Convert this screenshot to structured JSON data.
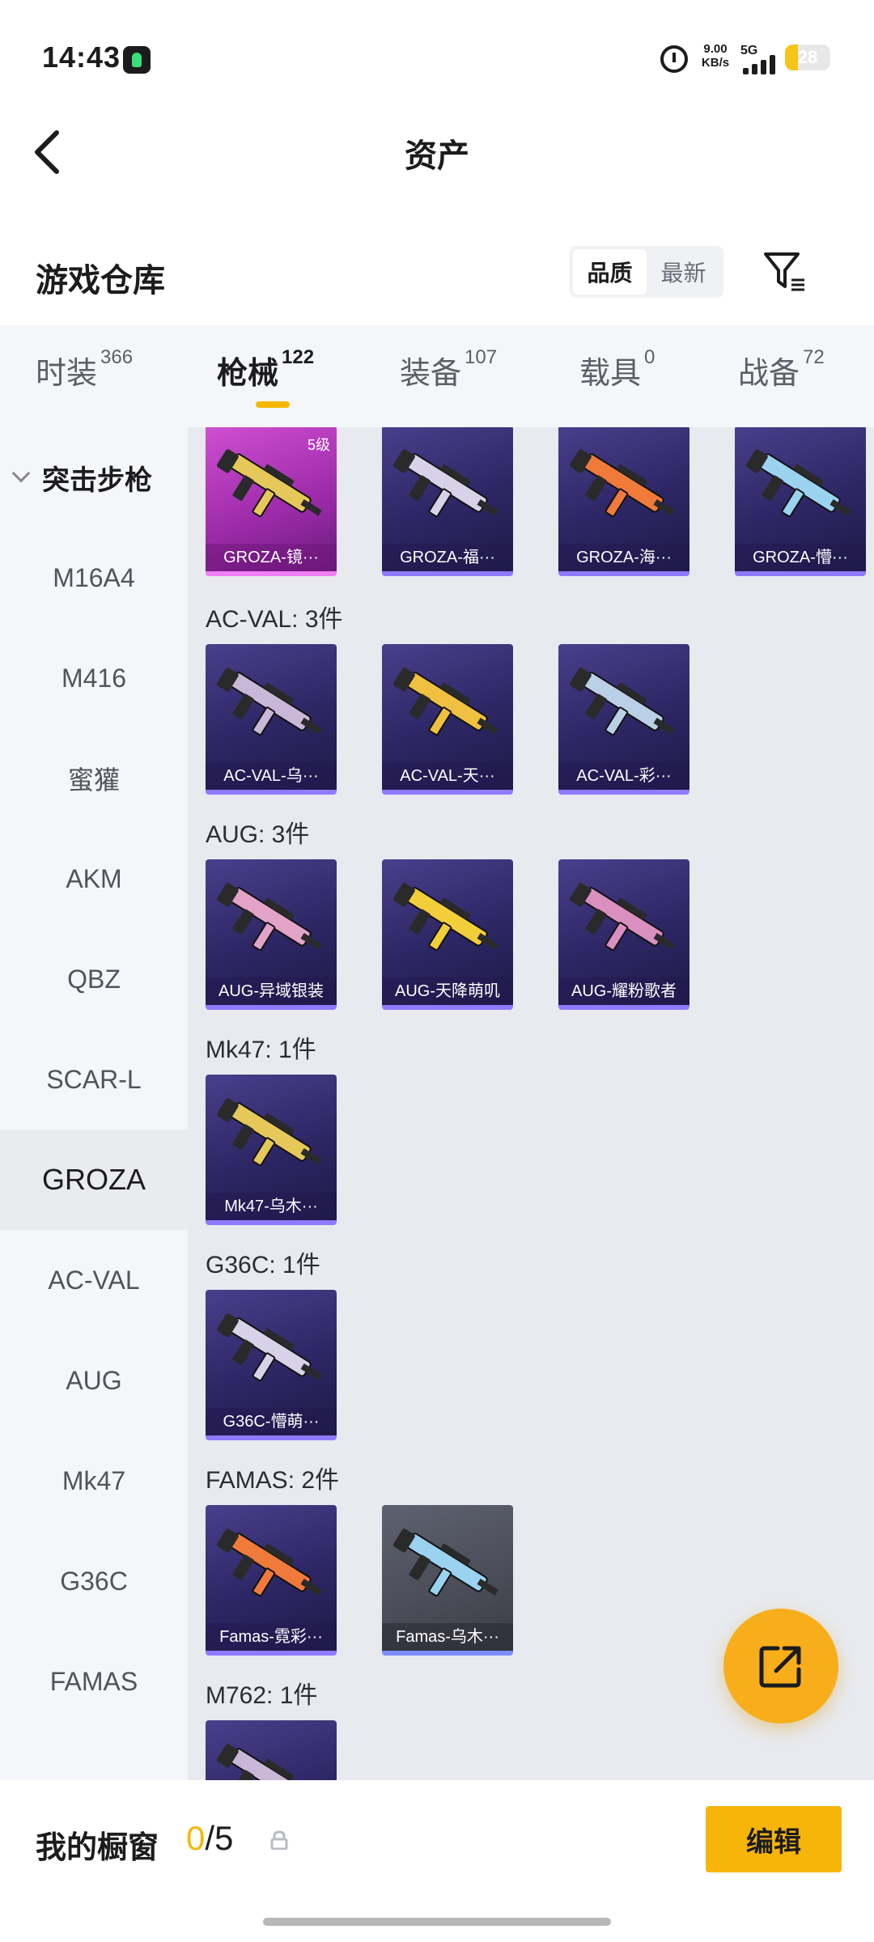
{
  "status_bar": {
    "time": "14:43",
    "speed_value": "9.00",
    "speed_unit": "KB/s",
    "network": "5G",
    "battery": "28",
    "battery_level": 0.28
  },
  "header": {
    "title": "资产"
  },
  "warehouse": {
    "title": "游戏仓库",
    "sort_options": [
      "品质",
      "最新"
    ],
    "active_sort": "品质"
  },
  "tabs": [
    {
      "label": "时装",
      "count": "366"
    },
    {
      "label": "枪械",
      "count": "122"
    },
    {
      "label": "装备",
      "count": "107"
    },
    {
      "label": "载具",
      "count": "0"
    },
    {
      "label": "战备",
      "count": "72"
    }
  ],
  "active_tab": "枪械",
  "sidebar": {
    "group": "突击步枪",
    "items": [
      "M16A4",
      "M416",
      "蜜獾",
      "AKM",
      "QBZ",
      "SCAR-L",
      "GROZA",
      "AC-VAL",
      "AUG",
      "Mk47",
      "G36C",
      "FAMAS"
    ],
    "active": "GROZA"
  },
  "content": {
    "top_cards": [
      {
        "name": "GROZA-镜···",
        "level": "5级",
        "style": "pink"
      },
      {
        "name": "GROZA-福···",
        "style": "purple"
      },
      {
        "name": "GROZA-海···",
        "style": "purple"
      },
      {
        "name": "GROZA-懵···",
        "style": "purple"
      }
    ],
    "groups": [
      {
        "label": "AC-VAL: 3件",
        "cards": [
          {
            "name": "AC-VAL-乌···",
            "style": "purple"
          },
          {
            "name": "AC-VAL-天···",
            "style": "purple"
          },
          {
            "name": "AC-VAL-彩···",
            "style": "purple"
          }
        ]
      },
      {
        "label": "AUG: 3件",
        "cards": [
          {
            "name": "AUG-异域银装",
            "style": "purple"
          },
          {
            "name": "AUG-天降萌叽",
            "style": "purple"
          },
          {
            "name": "AUG-耀粉歌者",
            "style": "purple"
          }
        ]
      },
      {
        "label": "Mk47: 1件",
        "cards": [
          {
            "name": "Mk47-乌木···",
            "style": "purple"
          }
        ]
      },
      {
        "label": "G36C: 1件",
        "cards": [
          {
            "name": "G36C-懵萌···",
            "style": "purple"
          }
        ]
      },
      {
        "label": "FAMAS: 2件",
        "cards": [
          {
            "name": "Famas-霓彩···",
            "style": "purple"
          },
          {
            "name": "Famas-乌木···",
            "style": "grey"
          }
        ]
      },
      {
        "label": "M762: 1件",
        "cards": [
          {
            "name": "",
            "style": "purple"
          }
        ]
      }
    ]
  },
  "bottom": {
    "showcase_label": "我的橱窗",
    "showcase_current": "0",
    "showcase_total": "/5",
    "edit_label": "编辑"
  },
  "colors": {
    "accent": "#f5b800",
    "card_purple": "#2d2664",
    "card_pink": "#9b2aa8",
    "card_grey": "#4a4c57",
    "card_border": "#8f79ff"
  }
}
